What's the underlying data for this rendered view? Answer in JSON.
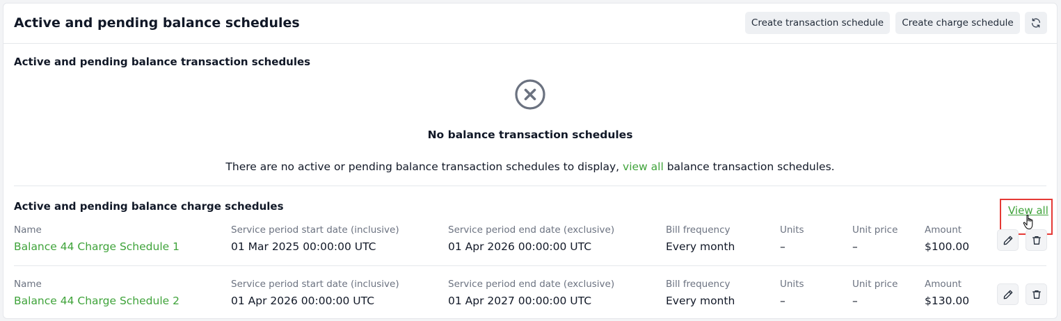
{
  "header": {
    "title": "Active and pending balance schedules",
    "create_transaction_label": "Create transaction schedule",
    "create_charge_label": "Create charge schedule",
    "refresh_icon": "refresh-icon"
  },
  "transaction_section": {
    "title": "Active and pending balance transaction schedules",
    "empty_icon": "x-circle-icon",
    "empty_title": "No balance transaction schedules",
    "empty_desc_before": "There are no active or pending balance transaction schedules to display,",
    "empty_link": "view all",
    "empty_desc_after": "balance transaction schedules."
  },
  "charge_section": {
    "title": "Active and pending balance charge schedules",
    "view_all_label": "View all",
    "columns": {
      "name": "Name",
      "start": "Service period start date (inclusive)",
      "end": "Service period end date (exclusive)",
      "frequency": "Bill frequency",
      "units": "Units",
      "unit_price": "Unit price",
      "amount": "Amount"
    },
    "rows": [
      {
        "name": "Balance 44 Charge Schedule 1",
        "start": "01 Mar 2025 00:00:00 UTC",
        "end": "01 Apr 2026 00:00:00 UTC",
        "frequency": "Every month",
        "units": "–",
        "unit_price": "–",
        "amount": "$100.00"
      },
      {
        "name": "Balance 44 Charge Schedule 2",
        "start": "01 Apr 2026 00:00:00 UTC",
        "end": "01 Apr 2027 00:00:00 UTC",
        "frequency": "Every month",
        "units": "–",
        "unit_price": "–",
        "amount": "$130.00"
      }
    ]
  },
  "colors": {
    "accent_green": "#3fa33a",
    "highlight_red": "#e53935",
    "button_bg": "#eef0f3"
  }
}
